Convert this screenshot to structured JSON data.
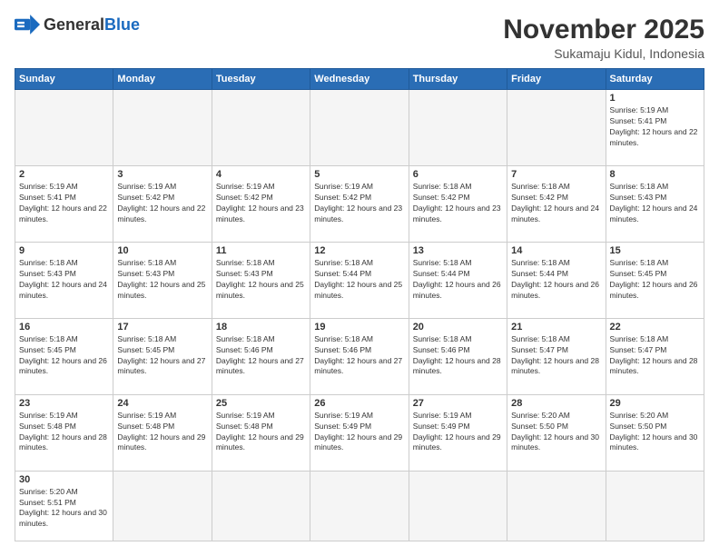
{
  "logo": {
    "general": "General",
    "blue": "Blue"
  },
  "title": "November 2025",
  "location": "Sukamaju Kidul, Indonesia",
  "days_header": [
    "Sunday",
    "Monday",
    "Tuesday",
    "Wednesday",
    "Thursday",
    "Friday",
    "Saturday"
  ],
  "weeks": [
    [
      {
        "day": "",
        "info": ""
      },
      {
        "day": "",
        "info": ""
      },
      {
        "day": "",
        "info": ""
      },
      {
        "day": "",
        "info": ""
      },
      {
        "day": "",
        "info": ""
      },
      {
        "day": "",
        "info": ""
      },
      {
        "day": "1",
        "info": "Sunrise: 5:19 AM\nSunset: 5:41 PM\nDaylight: 12 hours and 22 minutes."
      }
    ],
    [
      {
        "day": "2",
        "info": "Sunrise: 5:19 AM\nSunset: 5:41 PM\nDaylight: 12 hours and 22 minutes."
      },
      {
        "day": "3",
        "info": "Sunrise: 5:19 AM\nSunset: 5:42 PM\nDaylight: 12 hours and 22 minutes."
      },
      {
        "day": "4",
        "info": "Sunrise: 5:19 AM\nSunset: 5:42 PM\nDaylight: 12 hours and 23 minutes."
      },
      {
        "day": "5",
        "info": "Sunrise: 5:19 AM\nSunset: 5:42 PM\nDaylight: 12 hours and 23 minutes."
      },
      {
        "day": "6",
        "info": "Sunrise: 5:18 AM\nSunset: 5:42 PM\nDaylight: 12 hours and 23 minutes."
      },
      {
        "day": "7",
        "info": "Sunrise: 5:18 AM\nSunset: 5:42 PM\nDaylight: 12 hours and 24 minutes."
      },
      {
        "day": "8",
        "info": "Sunrise: 5:18 AM\nSunset: 5:43 PM\nDaylight: 12 hours and 24 minutes."
      }
    ],
    [
      {
        "day": "9",
        "info": "Sunrise: 5:18 AM\nSunset: 5:43 PM\nDaylight: 12 hours and 24 minutes."
      },
      {
        "day": "10",
        "info": "Sunrise: 5:18 AM\nSunset: 5:43 PM\nDaylight: 12 hours and 25 minutes."
      },
      {
        "day": "11",
        "info": "Sunrise: 5:18 AM\nSunset: 5:43 PM\nDaylight: 12 hours and 25 minutes."
      },
      {
        "day": "12",
        "info": "Sunrise: 5:18 AM\nSunset: 5:44 PM\nDaylight: 12 hours and 25 minutes."
      },
      {
        "day": "13",
        "info": "Sunrise: 5:18 AM\nSunset: 5:44 PM\nDaylight: 12 hours and 26 minutes."
      },
      {
        "day": "14",
        "info": "Sunrise: 5:18 AM\nSunset: 5:44 PM\nDaylight: 12 hours and 26 minutes."
      },
      {
        "day": "15",
        "info": "Sunrise: 5:18 AM\nSunset: 5:45 PM\nDaylight: 12 hours and 26 minutes."
      }
    ],
    [
      {
        "day": "16",
        "info": "Sunrise: 5:18 AM\nSunset: 5:45 PM\nDaylight: 12 hours and 26 minutes."
      },
      {
        "day": "17",
        "info": "Sunrise: 5:18 AM\nSunset: 5:45 PM\nDaylight: 12 hours and 27 minutes."
      },
      {
        "day": "18",
        "info": "Sunrise: 5:18 AM\nSunset: 5:46 PM\nDaylight: 12 hours and 27 minutes."
      },
      {
        "day": "19",
        "info": "Sunrise: 5:18 AM\nSunset: 5:46 PM\nDaylight: 12 hours and 27 minutes."
      },
      {
        "day": "20",
        "info": "Sunrise: 5:18 AM\nSunset: 5:46 PM\nDaylight: 12 hours and 28 minutes."
      },
      {
        "day": "21",
        "info": "Sunrise: 5:18 AM\nSunset: 5:47 PM\nDaylight: 12 hours and 28 minutes."
      },
      {
        "day": "22",
        "info": "Sunrise: 5:18 AM\nSunset: 5:47 PM\nDaylight: 12 hours and 28 minutes."
      }
    ],
    [
      {
        "day": "23",
        "info": "Sunrise: 5:19 AM\nSunset: 5:48 PM\nDaylight: 12 hours and 28 minutes."
      },
      {
        "day": "24",
        "info": "Sunrise: 5:19 AM\nSunset: 5:48 PM\nDaylight: 12 hours and 29 minutes."
      },
      {
        "day": "25",
        "info": "Sunrise: 5:19 AM\nSunset: 5:48 PM\nDaylight: 12 hours and 29 minutes."
      },
      {
        "day": "26",
        "info": "Sunrise: 5:19 AM\nSunset: 5:49 PM\nDaylight: 12 hours and 29 minutes."
      },
      {
        "day": "27",
        "info": "Sunrise: 5:19 AM\nSunset: 5:49 PM\nDaylight: 12 hours and 29 minutes."
      },
      {
        "day": "28",
        "info": "Sunrise: 5:20 AM\nSunset: 5:50 PM\nDaylight: 12 hours and 30 minutes."
      },
      {
        "day": "29",
        "info": "Sunrise: 5:20 AM\nSunset: 5:50 PM\nDaylight: 12 hours and 30 minutes."
      }
    ],
    [
      {
        "day": "30",
        "info": "Sunrise: 5:20 AM\nSunset: 5:51 PM\nDaylight: 12 hours and 30 minutes."
      },
      {
        "day": "",
        "info": ""
      },
      {
        "day": "",
        "info": ""
      },
      {
        "day": "",
        "info": ""
      },
      {
        "day": "",
        "info": ""
      },
      {
        "day": "",
        "info": ""
      },
      {
        "day": "",
        "info": ""
      }
    ]
  ]
}
